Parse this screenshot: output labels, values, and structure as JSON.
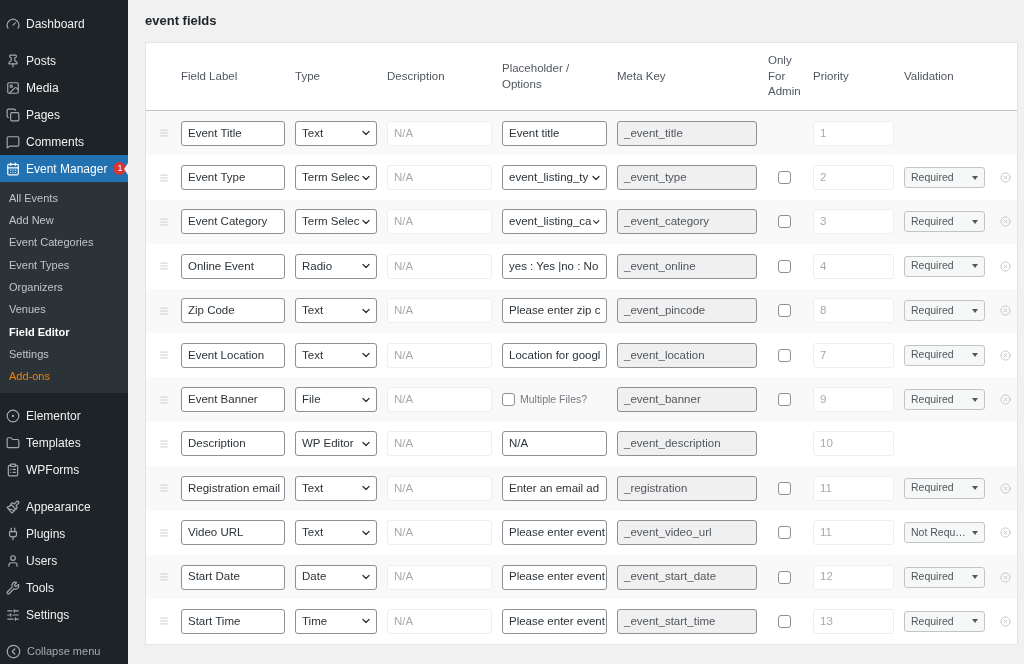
{
  "sidebar": {
    "groups": [
      {
        "items": [
          {
            "label": "Dashboard",
            "selected": false
          }
        ]
      },
      {
        "items": [
          {
            "label": "Posts",
            "selected": false
          },
          {
            "label": "Media",
            "selected": false
          },
          {
            "label": "Pages",
            "selected": false
          },
          {
            "label": "Comments",
            "selected": false
          },
          {
            "label": "Event Manager",
            "selected": true,
            "badge": "1",
            "submenu": [
              {
                "label": "All Events",
                "selected": false,
                "kind": "link"
              },
              {
                "label": "Add New",
                "selected": false,
                "kind": "link"
              },
              {
                "label": "Event Categories",
                "selected": false,
                "kind": "link"
              },
              {
                "label": "Event Types",
                "selected": false,
                "kind": "link"
              },
              {
                "label": "Organizers",
                "selected": false,
                "kind": "link"
              },
              {
                "label": "Venues",
                "selected": false,
                "kind": "link"
              },
              {
                "label": "Field Editor",
                "selected": true,
                "kind": "link"
              },
              {
                "label": "Settings",
                "selected": false,
                "kind": "link"
              },
              {
                "label": "Add-ons",
                "selected": false,
                "kind": "promo"
              }
            ]
          }
        ]
      },
      {
        "items": [
          {
            "label": "Elementor",
            "selected": false
          },
          {
            "label": "Templates",
            "selected": false
          },
          {
            "label": "WPForms",
            "selected": false
          }
        ]
      },
      {
        "items": [
          {
            "label": "Appearance",
            "selected": false
          },
          {
            "label": "Plugins",
            "selected": false
          },
          {
            "label": "Users",
            "selected": false
          },
          {
            "label": "Tools",
            "selected": false
          },
          {
            "label": "Settings",
            "selected": false
          }
        ]
      }
    ],
    "collapse": "Collapse menu"
  },
  "page_title": "event fields",
  "table": {
    "columns": [
      "Field Label",
      "Type",
      "Description",
      "Placeholder / Options",
      "Meta Key",
      "Only For Admin",
      "Priority",
      "Validation"
    ],
    "rows": [
      {
        "label": "Event Title",
        "type": "Text",
        "description": "N/A",
        "placeholder": {
          "kind": "input",
          "value": "Event title"
        },
        "meta_key": "_event_title",
        "priority": "1"
      },
      {
        "label": "Event Type",
        "type": "Term Selec",
        "description": "N/A",
        "placeholder": {
          "kind": "select",
          "value": "event_listing_ty"
        },
        "meta_key": "_event_type",
        "admin_only": false,
        "priority": "2",
        "validation": "Required"
      },
      {
        "label": "Event Category",
        "type": "Term Selec",
        "description": "N/A",
        "placeholder": {
          "kind": "select",
          "value": "event_listing_ca"
        },
        "meta_key": "_event_category",
        "admin_only": false,
        "priority": "3",
        "validation": "Required"
      },
      {
        "label": "Online Event",
        "type": "Radio",
        "description": "N/A",
        "placeholder": {
          "kind": "input",
          "value": "yes : Yes |no : No"
        },
        "meta_key": "_event_online",
        "admin_only": false,
        "priority": "4",
        "validation": "Required"
      },
      {
        "label": "Zip Code",
        "type": "Text",
        "description": "N/A",
        "placeholder": {
          "kind": "input",
          "value": "Please enter zip c"
        },
        "meta_key": "_event_pincode",
        "admin_only": false,
        "priority": "8",
        "validation": "Required"
      },
      {
        "label": "Event Location",
        "type": "Text",
        "description": "N/A",
        "placeholder": {
          "kind": "input",
          "value": "Location for googl"
        },
        "meta_key": "_event_location",
        "admin_only": false,
        "priority": "7",
        "validation": "Required"
      },
      {
        "label": "Event Banner",
        "type": "File",
        "description": "N/A",
        "placeholder": {
          "kind": "checkbox",
          "value": "Multiple Files?",
          "checked": false
        },
        "meta_key": "_event_banner",
        "admin_only": false,
        "priority": "9",
        "validation": "Required"
      },
      {
        "label": "Description",
        "type": "WP Editor",
        "description": "N/A",
        "placeholder": {
          "kind": "input",
          "value": "N/A"
        },
        "meta_key": "_event_description",
        "priority": "10"
      },
      {
        "label": "Registration email",
        "type": "Text",
        "description": "N/A",
        "placeholder": {
          "kind": "input",
          "value": "Enter an email ad"
        },
        "meta_key": "_registration",
        "admin_only": false,
        "priority": "11",
        "validation": "Required"
      },
      {
        "label": "Video URL",
        "type": "Text",
        "description": "N/A",
        "placeholder": {
          "kind": "input",
          "value": "Please enter event"
        },
        "meta_key": "_event_video_url",
        "admin_only": false,
        "priority": "11",
        "validation": "Not Requ…"
      },
      {
        "label": "Start Date",
        "type": "Date",
        "description": "N/A",
        "placeholder": {
          "kind": "input",
          "value": "Please enter event"
        },
        "meta_key": "_event_start_date",
        "admin_only": false,
        "priority": "12",
        "validation": "Required"
      },
      {
        "label": "Start Time",
        "type": "Time",
        "description": "N/A",
        "placeholder": {
          "kind": "input",
          "value": "Please enter event"
        },
        "meta_key": "_event_start_time",
        "admin_only": false,
        "priority": "13",
        "validation": "Required"
      }
    ]
  }
}
